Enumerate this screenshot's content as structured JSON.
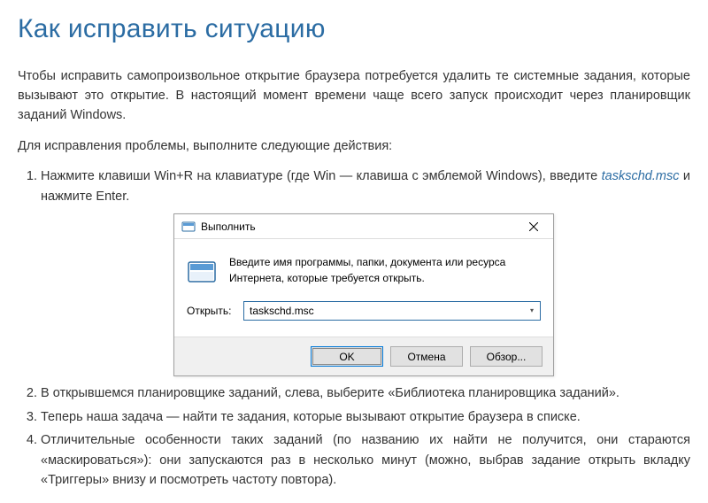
{
  "heading": "Как исправить ситуацию",
  "paragraph1": "Чтобы исправить самопроизвольное открытие браузера потребуется удалить те системные задания, которые вызывают это открытие. В настоящий момент времени чаще всего запуск происходит через планировщик заданий Windows.",
  "paragraph2": "Для исправления проблемы, выполните следующие действия:",
  "steps": {
    "s1_a": "Нажмите клавиши Win+R на клавиатуре (где Win — клавиша с эмблемой Windows), введите ",
    "s1_cmd": "taskschd.msc",
    "s1_b": " и нажмите Enter.",
    "s2": "В открывшемся планировщике заданий, слева, выберите «Библиотека планировщика заданий».",
    "s3": "Теперь наша задача — найти те задания, которые вызывают открытие браузера в списке.",
    "s4": "Отличительные особенности таких заданий (по названию их найти не получится, они стараются «маскироваться»): они запускаются раз в несколько минут (можно, выбрав задание открыть вкладку «Триггеры» внизу и посмотреть частоту повтора)."
  },
  "dialog": {
    "title": "Выполнить",
    "prompt": "Введите имя программы, папки, документа или ресурса Интернета, которые требуется открыть.",
    "open_label": "Открыть:",
    "value": "taskschd.msc",
    "ok": "OK",
    "cancel": "Отмена",
    "browse": "Обзор..."
  }
}
